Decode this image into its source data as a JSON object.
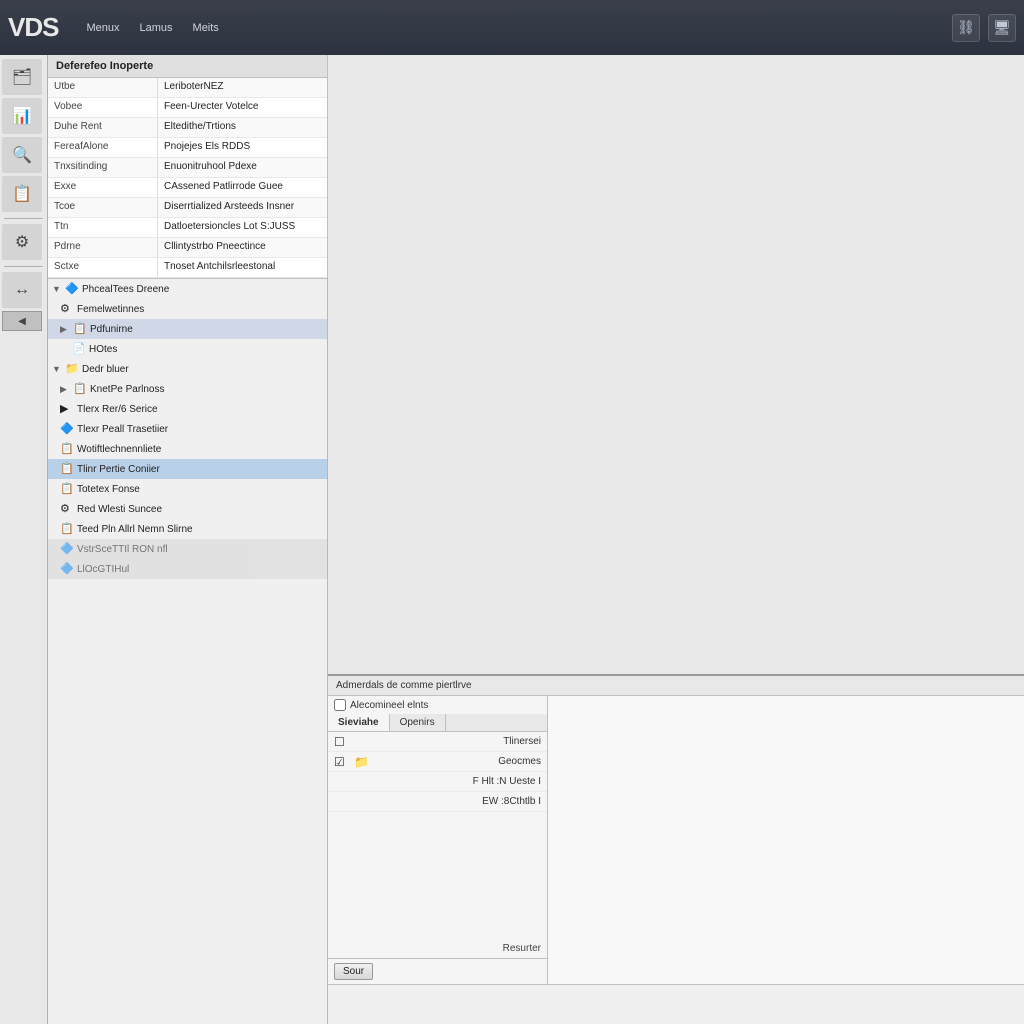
{
  "titlebar": {
    "logo": "VDS",
    "menu_items": [
      "Menux",
      "Lamus",
      "Meits"
    ],
    "icon_connect": "🔗",
    "icon_screen": "🖥"
  },
  "properties": {
    "title": "Deferefeo Inoperte",
    "rows": [
      {
        "label": "Utbe",
        "value": "LeriboterNEZ"
      },
      {
        "label": "Vobee",
        "value": "Feen-Urecter Votelce"
      },
      {
        "label": "Duhe Rent",
        "value": "Eltedithe/Trtions"
      },
      {
        "label": "FereafAlone",
        "value": "Pnojejes Els RDDS"
      },
      {
        "label": "Tnxsitinding",
        "value": "Enuonitruhool Pdexe"
      },
      {
        "label": "Exxe",
        "value": "CAssened Patlirrode Guee"
      },
      {
        "label": "Tcoe",
        "value": "Diserrtialized Arsteeds Insner"
      },
      {
        "label": "Ttn",
        "value": "Datloetersioncles Lot S:JUSS"
      },
      {
        "label": "Pdrne",
        "value": "Cllintystrbo Pneectince"
      },
      {
        "label": "Sctxe",
        "value": "Tnoset Antchilsrleestonal"
      }
    ]
  },
  "tree": {
    "root_items": [
      {
        "label": "PhcealTees Dreene",
        "indent": 0,
        "has_children": true,
        "icon": "🔷"
      },
      {
        "label": "Femelwetinnes",
        "indent": 1,
        "has_children": false,
        "icon": "⚙"
      },
      {
        "label": "Pdfunirne",
        "indent": 1,
        "has_children": true,
        "icon": "📋",
        "chevron": "▶"
      },
      {
        "label": "HOtes",
        "indent": 2,
        "has_children": false,
        "icon": "📄"
      },
      {
        "label": "Dedr bluer",
        "indent": 0,
        "has_children": true,
        "icon": "📁"
      },
      {
        "label": "KnetPe Parlnoss",
        "indent": 1,
        "has_children": true,
        "icon": "📋",
        "chevron": "▶"
      },
      {
        "label": "Tlerx Rer/6 Serice",
        "indent": 1,
        "has_children": false,
        "icon": "▶"
      },
      {
        "label": "Tlexr Peall Trasetiier",
        "indent": 1,
        "has_children": false,
        "icon": "🔷"
      },
      {
        "label": "Wotiftlechnennliete",
        "indent": 1,
        "has_children": false,
        "icon": "📋"
      },
      {
        "label": "Tlinr Pertie Coniier",
        "indent": 1,
        "has_children": false,
        "icon": "📋",
        "selected": true
      },
      {
        "label": "Totetex Fonse",
        "indent": 1,
        "has_children": false,
        "icon": "📋"
      },
      {
        "label": "Red Wlesti Suncee",
        "indent": 1,
        "has_children": false,
        "icon": "⚙"
      },
      {
        "label": "Teed Pln Allrl Nemn Slirne",
        "indent": 1,
        "has_children": false,
        "icon": "📋"
      },
      {
        "label": "VstrSceTTIl RON nfl",
        "indent": 1,
        "has_children": false,
        "icon": "🔷"
      },
      {
        "label": "LlOcGTIHul",
        "indent": 1,
        "has_children": false,
        "icon": "🔷"
      }
    ]
  },
  "bottom": {
    "toolbar_text": "Admerdals de comme piertlrve",
    "checkbox_label": "Alecomineel elnts",
    "tabs": [
      "Sieviahe",
      "Openirs"
    ],
    "list_items": [
      {
        "icon": "☐",
        "text": "Tlinersei",
        "type": "unchecked"
      },
      {
        "icon": "☑",
        "text": "Geocmes",
        "type": "checked",
        "has_sub": "📁"
      },
      {
        "sub_text": "F Hlt :N Ueste I"
      },
      {
        "sub_text": "EW :8Cthtlb I"
      }
    ],
    "remember_text": "Resurter",
    "buttons": [
      "Sour"
    ]
  }
}
